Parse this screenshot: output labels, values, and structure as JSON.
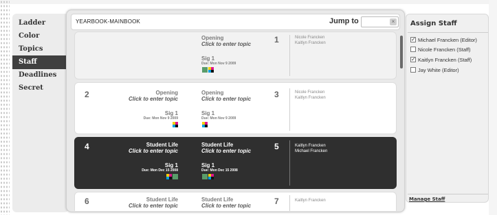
{
  "nav": {
    "items": [
      "Ladder",
      "Color",
      "Topics",
      "Staff",
      "Deadlines",
      "Secret"
    ],
    "active": "Staff"
  },
  "header": {
    "title": "YEARBOOK-MAINBOOK",
    "jump_label": "Jump to",
    "jump_value": ""
  },
  "spreads": [
    {
      "left": null,
      "right": {
        "num": "1",
        "title": "Opening",
        "topic": "Click to enter topic",
        "sig": "Sig 1",
        "due": "Due: Mon Nov 9 2009",
        "icons": [
          "green",
          "cmyk"
        ]
      },
      "staff": [
        "Nicole Francken",
        "Kaitlyn Francken"
      ]
    },
    {
      "left": {
        "num": "2",
        "title": "Opening",
        "topic": "Click to enter topic",
        "sig": "Sig 1",
        "due": "Due: Mon Nov 9 2009",
        "icons": [
          "cmyk"
        ]
      },
      "right": {
        "num": "3",
        "title": "Opening",
        "topic": "Click to enter topic",
        "sig": "Sig 1",
        "due": "Due: Mon Nov 9 2009",
        "icons": [
          "cmyk"
        ]
      },
      "staff": [
        "Nicole Francken",
        "Kaitlyn Francken"
      ]
    },
    {
      "left": {
        "num": "4",
        "title": "Student Life",
        "topic": "Click to enter topic",
        "sig": "Sig 1",
        "due": "Due: Mon Dec 15 2008",
        "icons": [
          "cmyk",
          "green"
        ]
      },
      "right": {
        "num": "5",
        "title": "Student Life",
        "topic": "Click to enter topic",
        "sig": "Sig 1",
        "due": "Due: Mon Dec 15 2008",
        "icons": [
          "green",
          "cmyk"
        ]
      },
      "staff": [
        "Kaitlyn Francken",
        "Michael Francken"
      ]
    },
    {
      "left": {
        "num": "6",
        "title": "Student Life",
        "topic": "Click to enter topic"
      },
      "right": {
        "num": "7",
        "title": "Student Life",
        "topic": "Click to enter topic"
      },
      "staff": [
        "Kaitlyn Francken"
      ]
    }
  ],
  "assign": {
    "title": "Assign Staff",
    "staff": [
      {
        "name": "Michael Francken (Editor)",
        "checked": true
      },
      {
        "name": "Nicole Francken (Staff)",
        "checked": false
      },
      {
        "name": "Kaitlyn Francken (Staff)",
        "checked": true
      },
      {
        "name": "Jay White (Editor)",
        "checked": false
      }
    ],
    "manage_label": "Manage Staff"
  },
  "colors": {
    "active_nav": "#404040",
    "selected_spread": "#2f2f2f"
  }
}
